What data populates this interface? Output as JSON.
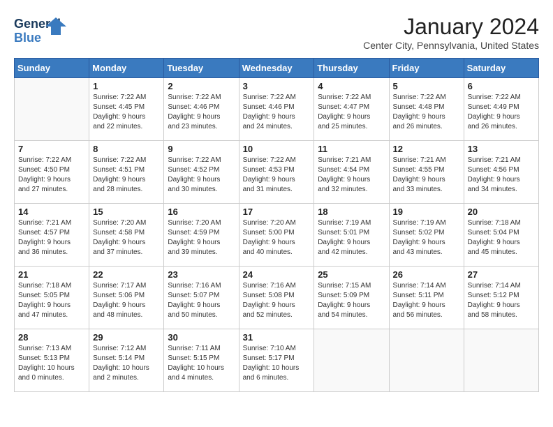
{
  "header": {
    "logo_general": "General",
    "logo_blue": "Blue",
    "month_title": "January 2024",
    "location": "Center City, Pennsylvania, United States"
  },
  "weekdays": [
    "Sunday",
    "Monday",
    "Tuesday",
    "Wednesday",
    "Thursday",
    "Friday",
    "Saturday"
  ],
  "weeks": [
    [
      {
        "day": "",
        "info": ""
      },
      {
        "day": "1",
        "info": "Sunrise: 7:22 AM\nSunset: 4:45 PM\nDaylight: 9 hours\nand 22 minutes."
      },
      {
        "day": "2",
        "info": "Sunrise: 7:22 AM\nSunset: 4:46 PM\nDaylight: 9 hours\nand 23 minutes."
      },
      {
        "day": "3",
        "info": "Sunrise: 7:22 AM\nSunset: 4:46 PM\nDaylight: 9 hours\nand 24 minutes."
      },
      {
        "day": "4",
        "info": "Sunrise: 7:22 AM\nSunset: 4:47 PM\nDaylight: 9 hours\nand 25 minutes."
      },
      {
        "day": "5",
        "info": "Sunrise: 7:22 AM\nSunset: 4:48 PM\nDaylight: 9 hours\nand 26 minutes."
      },
      {
        "day": "6",
        "info": "Sunrise: 7:22 AM\nSunset: 4:49 PM\nDaylight: 9 hours\nand 26 minutes."
      }
    ],
    [
      {
        "day": "7",
        "info": "Sunrise: 7:22 AM\nSunset: 4:50 PM\nDaylight: 9 hours\nand 27 minutes."
      },
      {
        "day": "8",
        "info": "Sunrise: 7:22 AM\nSunset: 4:51 PM\nDaylight: 9 hours\nand 28 minutes."
      },
      {
        "day": "9",
        "info": "Sunrise: 7:22 AM\nSunset: 4:52 PM\nDaylight: 9 hours\nand 30 minutes."
      },
      {
        "day": "10",
        "info": "Sunrise: 7:22 AM\nSunset: 4:53 PM\nDaylight: 9 hours\nand 31 minutes."
      },
      {
        "day": "11",
        "info": "Sunrise: 7:21 AM\nSunset: 4:54 PM\nDaylight: 9 hours\nand 32 minutes."
      },
      {
        "day": "12",
        "info": "Sunrise: 7:21 AM\nSunset: 4:55 PM\nDaylight: 9 hours\nand 33 minutes."
      },
      {
        "day": "13",
        "info": "Sunrise: 7:21 AM\nSunset: 4:56 PM\nDaylight: 9 hours\nand 34 minutes."
      }
    ],
    [
      {
        "day": "14",
        "info": "Sunrise: 7:21 AM\nSunset: 4:57 PM\nDaylight: 9 hours\nand 36 minutes."
      },
      {
        "day": "15",
        "info": "Sunrise: 7:20 AM\nSunset: 4:58 PM\nDaylight: 9 hours\nand 37 minutes."
      },
      {
        "day": "16",
        "info": "Sunrise: 7:20 AM\nSunset: 4:59 PM\nDaylight: 9 hours\nand 39 minutes."
      },
      {
        "day": "17",
        "info": "Sunrise: 7:20 AM\nSunset: 5:00 PM\nDaylight: 9 hours\nand 40 minutes."
      },
      {
        "day": "18",
        "info": "Sunrise: 7:19 AM\nSunset: 5:01 PM\nDaylight: 9 hours\nand 42 minutes."
      },
      {
        "day": "19",
        "info": "Sunrise: 7:19 AM\nSunset: 5:02 PM\nDaylight: 9 hours\nand 43 minutes."
      },
      {
        "day": "20",
        "info": "Sunrise: 7:18 AM\nSunset: 5:04 PM\nDaylight: 9 hours\nand 45 minutes."
      }
    ],
    [
      {
        "day": "21",
        "info": "Sunrise: 7:18 AM\nSunset: 5:05 PM\nDaylight: 9 hours\nand 47 minutes."
      },
      {
        "day": "22",
        "info": "Sunrise: 7:17 AM\nSunset: 5:06 PM\nDaylight: 9 hours\nand 48 minutes."
      },
      {
        "day": "23",
        "info": "Sunrise: 7:16 AM\nSunset: 5:07 PM\nDaylight: 9 hours\nand 50 minutes."
      },
      {
        "day": "24",
        "info": "Sunrise: 7:16 AM\nSunset: 5:08 PM\nDaylight: 9 hours\nand 52 minutes."
      },
      {
        "day": "25",
        "info": "Sunrise: 7:15 AM\nSunset: 5:09 PM\nDaylight: 9 hours\nand 54 minutes."
      },
      {
        "day": "26",
        "info": "Sunrise: 7:14 AM\nSunset: 5:11 PM\nDaylight: 9 hours\nand 56 minutes."
      },
      {
        "day": "27",
        "info": "Sunrise: 7:14 AM\nSunset: 5:12 PM\nDaylight: 9 hours\nand 58 minutes."
      }
    ],
    [
      {
        "day": "28",
        "info": "Sunrise: 7:13 AM\nSunset: 5:13 PM\nDaylight: 10 hours\nand 0 minutes."
      },
      {
        "day": "29",
        "info": "Sunrise: 7:12 AM\nSunset: 5:14 PM\nDaylight: 10 hours\nand 2 minutes."
      },
      {
        "day": "30",
        "info": "Sunrise: 7:11 AM\nSunset: 5:15 PM\nDaylight: 10 hours\nand 4 minutes."
      },
      {
        "day": "31",
        "info": "Sunrise: 7:10 AM\nSunset: 5:17 PM\nDaylight: 10 hours\nand 6 minutes."
      },
      {
        "day": "",
        "info": ""
      },
      {
        "day": "",
        "info": ""
      },
      {
        "day": "",
        "info": ""
      }
    ]
  ]
}
